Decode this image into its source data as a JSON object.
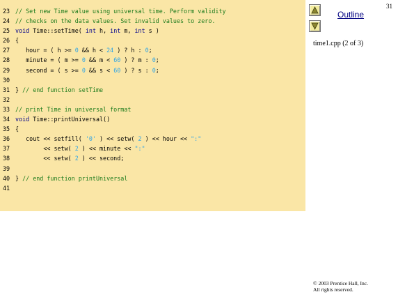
{
  "slide_number": "31",
  "navigation": {
    "up_icon": "triangle-up-icon",
    "down_icon": "triangle-down-icon",
    "outline_label": "Outline",
    "file_label": "time1.cpp (2 of 3)"
  },
  "copyright": {
    "line1": "© 2003 Prentice Hall, Inc.",
    "line2": "All rights reserved."
  },
  "colors": {
    "panel_background": "#fae6a6",
    "comment": "#1b7a1b",
    "keyword": "#00008b",
    "literal": "#2fa4e7"
  },
  "code": {
    "lines": [
      {
        "num": "23",
        "tokens": [
          {
            "t": "// Set new Time value using universal time. Perform validity",
            "c": "c"
          }
        ]
      },
      {
        "num": "24",
        "tokens": [
          {
            "t": "// checks on the data values. Set invalid values to zero.",
            "c": "c"
          }
        ]
      },
      {
        "num": "25",
        "tokens": [
          {
            "t": "void",
            "c": "k"
          },
          {
            "t": " Time::setTime( ",
            "c": ""
          },
          {
            "t": "int",
            "c": "k"
          },
          {
            "t": " h, ",
            "c": ""
          },
          {
            "t": "int",
            "c": "k"
          },
          {
            "t": " m, ",
            "c": ""
          },
          {
            "t": "int",
            "c": "k"
          },
          {
            "t": " s )",
            "c": ""
          }
        ]
      },
      {
        "num": "26",
        "tokens": [
          {
            "t": "{",
            "c": ""
          }
        ]
      },
      {
        "num": "27",
        "tokens": [
          {
            "t": "   hour = ( h >= ",
            "c": ""
          },
          {
            "t": "0",
            "c": "n"
          },
          {
            "t": " && h < ",
            "c": ""
          },
          {
            "t": "24",
            "c": "n"
          },
          {
            "t": " ) ? h : ",
            "c": ""
          },
          {
            "t": "0",
            "c": "n"
          },
          {
            "t": ";",
            "c": ""
          }
        ]
      },
      {
        "num": "28",
        "tokens": [
          {
            "t": "   minute = ( m >= ",
            "c": ""
          },
          {
            "t": "0",
            "c": "n"
          },
          {
            "t": " && m < ",
            "c": ""
          },
          {
            "t": "60",
            "c": "n"
          },
          {
            "t": " ) ? m : ",
            "c": ""
          },
          {
            "t": "0",
            "c": "n"
          },
          {
            "t": ";",
            "c": ""
          }
        ]
      },
      {
        "num": "29",
        "tokens": [
          {
            "t": "   second = ( s >= ",
            "c": ""
          },
          {
            "t": "0",
            "c": "n"
          },
          {
            "t": " && s < ",
            "c": ""
          },
          {
            "t": "60",
            "c": "n"
          },
          {
            "t": " ) ? s : ",
            "c": ""
          },
          {
            "t": "0",
            "c": "n"
          },
          {
            "t": ";",
            "c": ""
          }
        ]
      },
      {
        "num": "30",
        "tokens": []
      },
      {
        "num": "31",
        "tokens": [
          {
            "t": "} ",
            "c": ""
          },
          {
            "t": "// end function setTime",
            "c": "c"
          }
        ]
      },
      {
        "num": "32",
        "tokens": []
      },
      {
        "num": "33",
        "tokens": [
          {
            "t": "// print Time in universal format",
            "c": "c"
          }
        ]
      },
      {
        "num": "34",
        "tokens": [
          {
            "t": "void",
            "c": "k"
          },
          {
            "t": " Time::printUniversal()",
            "c": ""
          }
        ]
      },
      {
        "num": "35",
        "tokens": [
          {
            "t": "{",
            "c": ""
          }
        ]
      },
      {
        "num": "36",
        "tokens": [
          {
            "t": "   cout << setfill( ",
            "c": ""
          },
          {
            "t": "'0'",
            "c": "s"
          },
          {
            "t": " ) << setw( ",
            "c": ""
          },
          {
            "t": "2",
            "c": "n"
          },
          {
            "t": " ) << hour << ",
            "c": ""
          },
          {
            "t": "\":\"",
            "c": "s"
          }
        ]
      },
      {
        "num": "37",
        "tokens": [
          {
            "t": "        << setw( ",
            "c": ""
          },
          {
            "t": "2",
            "c": "n"
          },
          {
            "t": " ) << minute << ",
            "c": ""
          },
          {
            "t": "\":\"",
            "c": "s"
          }
        ]
      },
      {
        "num": "38",
        "tokens": [
          {
            "t": "        << setw( ",
            "c": ""
          },
          {
            "t": "2",
            "c": "n"
          },
          {
            "t": " ) << second;",
            "c": ""
          }
        ]
      },
      {
        "num": "39",
        "tokens": []
      },
      {
        "num": "40",
        "tokens": [
          {
            "t": "} ",
            "c": ""
          },
          {
            "t": "// end function printUniversal",
            "c": "c"
          }
        ]
      },
      {
        "num": "41",
        "tokens": []
      }
    ]
  }
}
